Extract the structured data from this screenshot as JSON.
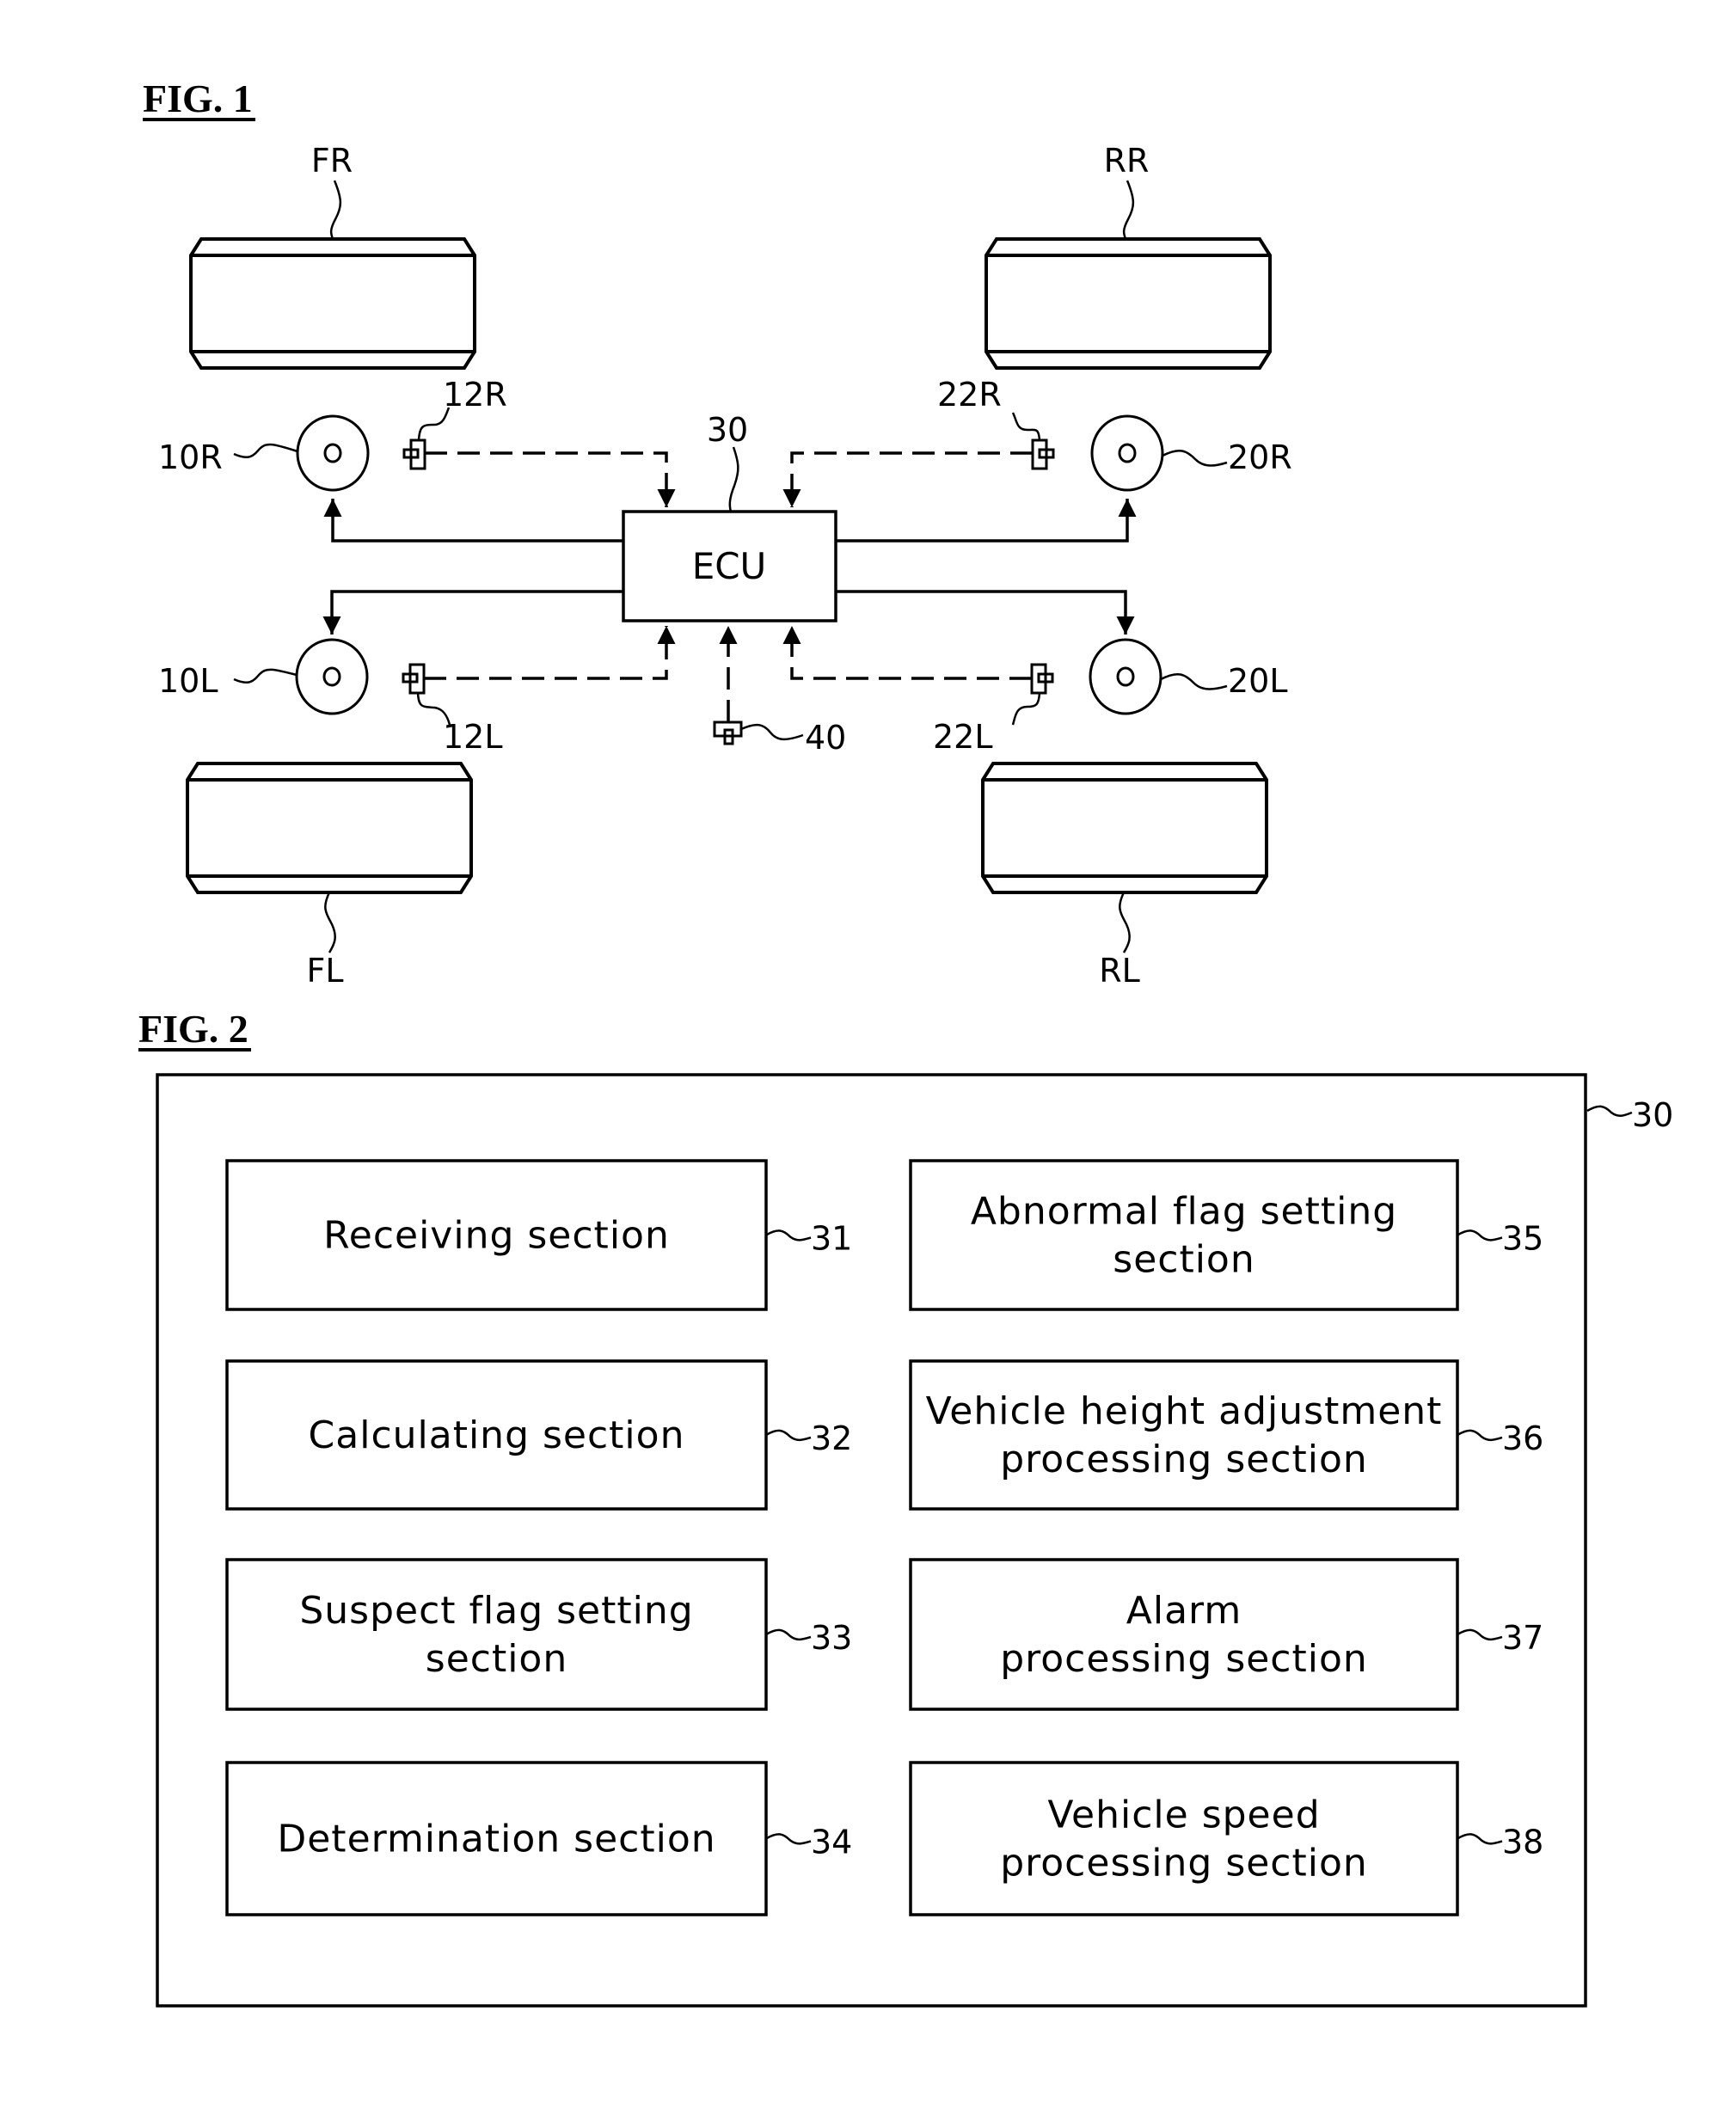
{
  "fig1": {
    "title": "FIG. 1",
    "tires": {
      "FR": "FR",
      "RR": "RR",
      "FL": "FL",
      "RL": "RL"
    },
    "wheels": {
      "w10R": "10R",
      "w20R": "20R",
      "w10L": "10L",
      "w20L": "20L"
    },
    "sensors": {
      "s12R": "12R",
      "s22R": "22R",
      "s12L": "12L",
      "s22L": "22L",
      "s40": "40"
    },
    "ecu": {
      "label": "ECU",
      "ref": "30"
    }
  },
  "fig2": {
    "title": "FIG. 2",
    "container_ref": "30",
    "sections": [
      {
        "lines": [
          "Receiving section"
        ],
        "ref": "31"
      },
      {
        "lines": [
          "Calculating section"
        ],
        "ref": "32"
      },
      {
        "lines": [
          "Suspect flag setting",
          "section"
        ],
        "ref": "33"
      },
      {
        "lines": [
          "Determination section"
        ],
        "ref": "34"
      },
      {
        "lines": [
          "Abnormal flag setting",
          "section"
        ],
        "ref": "35"
      },
      {
        "lines": [
          "Vehicle height adjustment",
          "processing section"
        ],
        "ref": "36"
      },
      {
        "lines": [
          "Alarm",
          "processing section"
        ],
        "ref": "37"
      },
      {
        "lines": [
          "Vehicle speed",
          "processing section"
        ],
        "ref": "38"
      }
    ]
  }
}
